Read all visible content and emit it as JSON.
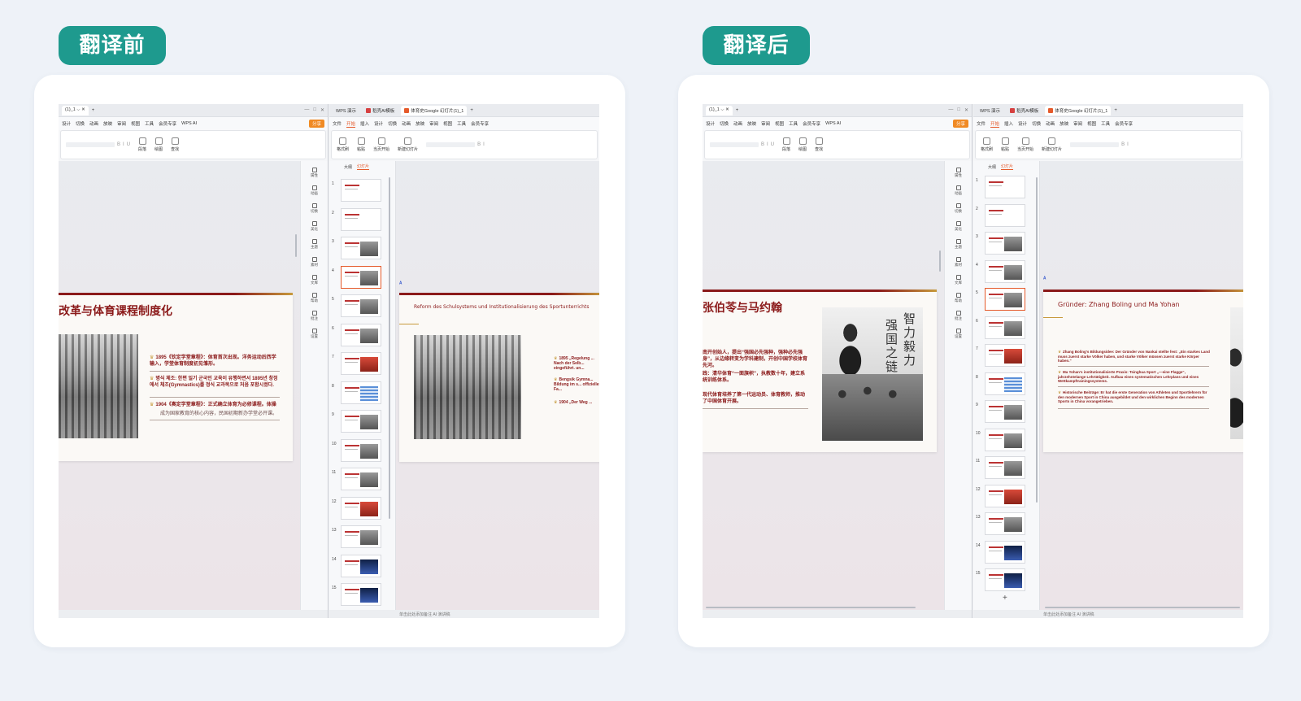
{
  "labels": {
    "before": "翻译前",
    "after": "翻译后"
  },
  "window": {
    "tabs": [
      "WPS 演示",
      "稻壳AI模板",
      "体育史Google 幻灯片(1)_1"
    ],
    "menu_left": [
      "设计",
      "切换",
      "动画",
      "放映",
      "审阅",
      "视图",
      "工具",
      "会员专享",
      "WPS AI"
    ],
    "menu_right": [
      "文件",
      "开始",
      "插入",
      "设计",
      "切换",
      "动画",
      "放映",
      "审阅",
      "视图",
      "工具",
      "会员专享"
    ],
    "share": "分享",
    "ribbon_left": [
      "段落",
      "绘图",
      "查找"
    ],
    "ribbon_right": [
      "格式刷",
      "粘贴",
      "当页开始",
      "新建幻灯片"
    ],
    "panel_tabs": [
      "大纲",
      "幻灯片"
    ],
    "sidebar": [
      "属性",
      "动画",
      "切换",
      "美化",
      "主题",
      "素材",
      "文库",
      "帮助",
      "批注",
      "设置"
    ],
    "status_right": "单击此处添加备注",
    "status_ai": "AI 演讲稿"
  },
  "before": {
    "main_title": "改革与体育课程制度化",
    "bullets": [
      {
        "text": "1895《钦定学堂章程》：体育首次出现。洋务运动后西学输入，学堂体育制度初见雏形。",
        "style": "bold"
      },
      {
        "text": "병식 체조: 한편 일기 군국민 교육이 유행하면서 1895년 창정에서 체조(Gymnastics)를 정식 교과목으로 처음 포함시켰다.",
        "style": "bold"
      },
      {
        "text": "1904《奏定学堂章程》：正式确立体育为必修课程。体操",
        "style": "bold"
      },
      {
        "text": "成为国家教育的核心内容，民国初期新办学堂必开课。",
        "style": "plain"
      }
    ],
    "preview_title": "Reform des Schulsystems und Institutionalisierung des Sportunterrichts",
    "preview_bullets": [
      "1895 „Regelung ... Nach der Selb... eingeführt. un...",
      "Bengsik Gymna... Bildung im s... offizielles Fa...",
      "1904 „Der Weg ..."
    ],
    "thumb_count": 15
  },
  "after": {
    "main_title": "张伯苓与马约翰",
    "bullets": [
      {
        "text": "南开创始人，提出“强国必先强种，强种必先强身”，从边缘转变为学科建制，开创中国学校体育先河。",
        "style": "bold"
      },
      {
        "text": "践：清华体育“一面旗帜”，执教数十年，建立系统训练体系。",
        "style": "bold"
      },
      {
        "text": "现代体育培养了第一代运动员、体育教师，推动了中国体育开展。",
        "style": "bold"
      }
    ],
    "calligraphy": [
      "智力毅力",
      "强国之链"
    ],
    "preview_title": "Gründer: Zhang Boling und Ma Yohan",
    "preview_bullets": [
      "Zhang Boling's Bildungsidee: Der Gründer von Nankai stellte fest: „Ein starkes Land muss zuerst starke Völker haben, und starke Völker müssen zuerst starke Körper haben.“",
      "Ma Yohan's institutionalisierte Praxis: Tsinghua Sport „—eine Flagge“, jahrzehntelange Lehrtätigkeit. Aufbau eines systematischen Lehrplans und eines Wettkampftrainingssystems.",
      "Historische Beiträge: Er hat die erste Generation von Athleten und Sportlehrern für den modernen Sport in China ausgebildet und den wirklichen Beginn des modernen Sports in China vorangetrieben."
    ],
    "thumb_count": 15
  },
  "colors": {
    "accent": "#1e9a8e",
    "brand": "#8b1a1a",
    "gold": "#c79a3c",
    "wps_orange": "#e55a2b"
  },
  "icons": [
    "gold-medal-icon",
    "wps-ai-icon",
    "plus-icon",
    "gear-icon"
  ]
}
